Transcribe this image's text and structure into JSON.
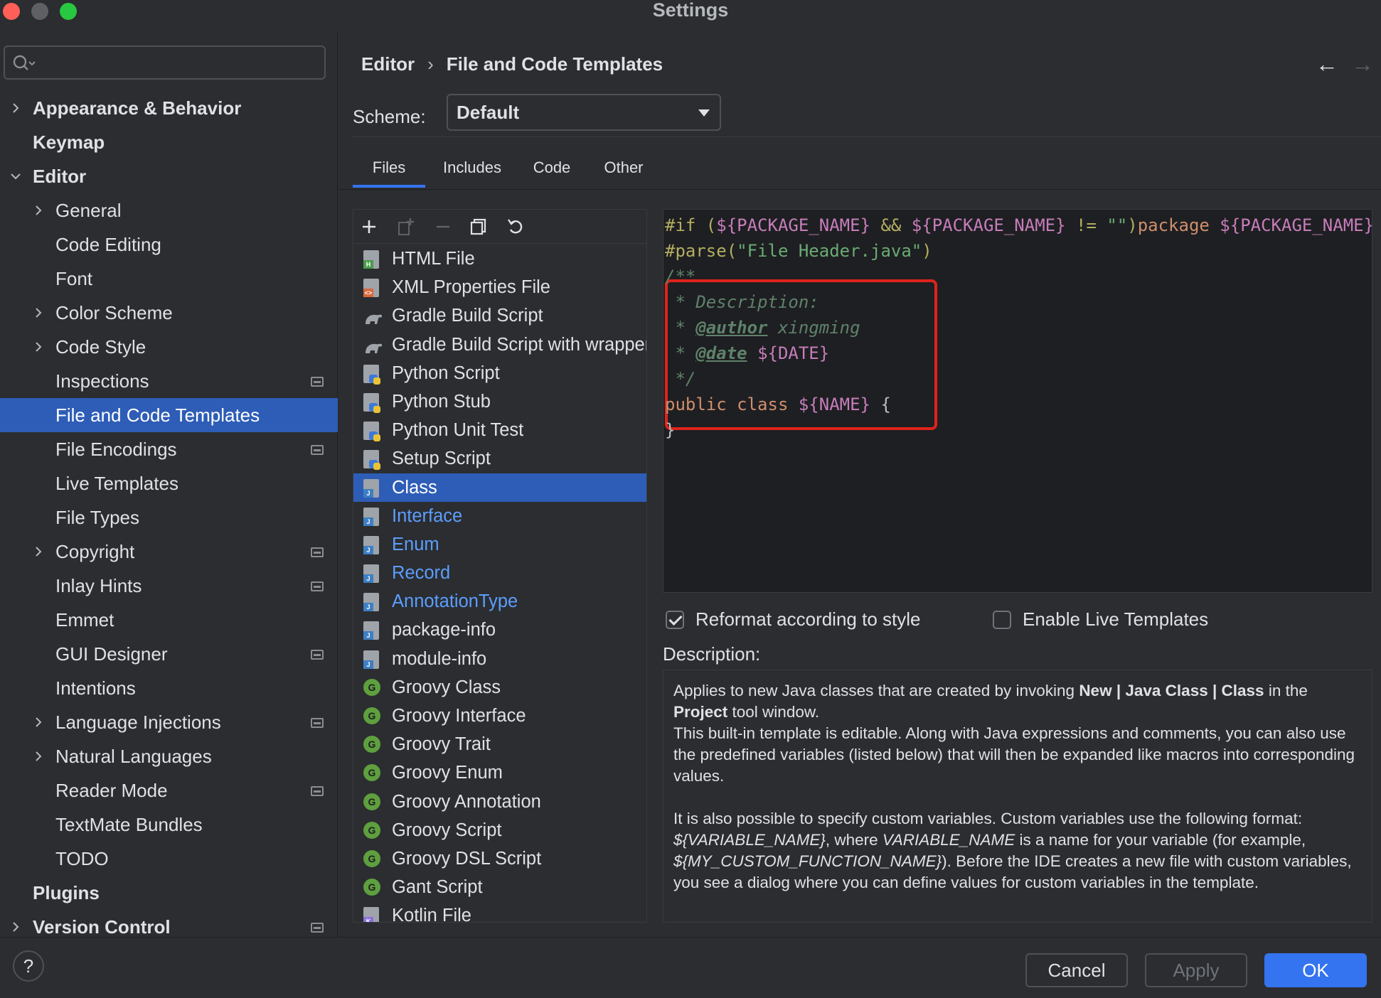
{
  "window": {
    "title": "Settings"
  },
  "search": {
    "placeholder": ""
  },
  "sidebar": {
    "items": [
      {
        "label": "Appearance & Behavior",
        "level": 0,
        "arrow": "right",
        "bold": true,
        "project": false
      },
      {
        "label": "Keymap",
        "level": 0,
        "arrow": "",
        "bold": true,
        "project": false
      },
      {
        "label": "Editor",
        "level": 0,
        "arrow": "down",
        "bold": true,
        "project": false
      },
      {
        "label": "General",
        "level": 1,
        "arrow": "right",
        "bold": false,
        "project": false
      },
      {
        "label": "Code Editing",
        "level": 1,
        "arrow": "",
        "bold": false,
        "project": false
      },
      {
        "label": "Font",
        "level": 1,
        "arrow": "",
        "bold": false,
        "project": false
      },
      {
        "label": "Color Scheme",
        "level": 1,
        "arrow": "right",
        "bold": false,
        "project": false
      },
      {
        "label": "Code Style",
        "level": 1,
        "arrow": "right",
        "bold": false,
        "project": false
      },
      {
        "label": "Inspections",
        "level": 1,
        "arrow": "",
        "bold": false,
        "project": true
      },
      {
        "label": "File and Code Templates",
        "level": 1,
        "arrow": "",
        "bold": false,
        "project": false,
        "selected": true
      },
      {
        "label": "File Encodings",
        "level": 1,
        "arrow": "",
        "bold": false,
        "project": true
      },
      {
        "label": "Live Templates",
        "level": 1,
        "arrow": "",
        "bold": false,
        "project": false
      },
      {
        "label": "File Types",
        "level": 1,
        "arrow": "",
        "bold": false,
        "project": false
      },
      {
        "label": "Copyright",
        "level": 1,
        "arrow": "right",
        "bold": false,
        "project": true
      },
      {
        "label": "Inlay Hints",
        "level": 1,
        "arrow": "",
        "bold": false,
        "project": true
      },
      {
        "label": "Emmet",
        "level": 1,
        "arrow": "",
        "bold": false,
        "project": false
      },
      {
        "label": "GUI Designer",
        "level": 1,
        "arrow": "",
        "bold": false,
        "project": true
      },
      {
        "label": "Intentions",
        "level": 1,
        "arrow": "",
        "bold": false,
        "project": false
      },
      {
        "label": "Language Injections",
        "level": 1,
        "arrow": "right",
        "bold": false,
        "project": true
      },
      {
        "label": "Natural Languages",
        "level": 1,
        "arrow": "right",
        "bold": false,
        "project": false
      },
      {
        "label": "Reader Mode",
        "level": 1,
        "arrow": "",
        "bold": false,
        "project": true
      },
      {
        "label": "TextMate Bundles",
        "level": 1,
        "arrow": "",
        "bold": false,
        "project": false
      },
      {
        "label": "TODO",
        "level": 1,
        "arrow": "",
        "bold": false,
        "project": false
      },
      {
        "label": "Plugins",
        "level": 0,
        "arrow": "",
        "bold": true,
        "project": false
      },
      {
        "label": "Version Control",
        "level": 0,
        "arrow": "right",
        "bold": true,
        "project": true
      }
    ]
  },
  "header": {
    "breadcrumb": [
      "Editor",
      "File and Code Templates"
    ],
    "separator": "›",
    "back": "←",
    "forward": "→"
  },
  "scheme": {
    "label": "Scheme:",
    "value": "Default"
  },
  "tabs": [
    {
      "label": "Files",
      "active": true
    },
    {
      "label": "Includes",
      "active": false
    },
    {
      "label": "Code",
      "active": false
    },
    {
      "label": "Other",
      "active": false
    }
  ],
  "templates": [
    {
      "label": "HTML File",
      "icon": "html-file-icon",
      "badge": "H",
      "badgeColor": "#4a9c4a",
      "style": "normal"
    },
    {
      "label": "XML Properties File",
      "icon": "xml-file-icon",
      "badge": "<>",
      "badgeColor": "#d9683c",
      "style": "normal"
    },
    {
      "label": "Gradle Build Script",
      "icon": "gradle-icon",
      "badge": "",
      "badgeColor": "",
      "style": "normal"
    },
    {
      "label": "Gradle Build Script with wrapper",
      "icon": "gradle-icon",
      "badge": "",
      "badgeColor": "",
      "style": "normal"
    },
    {
      "label": "Python Script",
      "icon": "python-file-icon",
      "badge": "",
      "badgeColor": "#3c78d8",
      "style": "normal"
    },
    {
      "label": "Python Stub",
      "icon": "python-file-icon",
      "badge": "",
      "badgeColor": "#3c78d8",
      "style": "normal"
    },
    {
      "label": "Python Unit Test",
      "icon": "python-file-icon",
      "badge": "",
      "badgeColor": "#3c78d8",
      "style": "normal"
    },
    {
      "label": "Setup Script",
      "icon": "python-file-icon",
      "badge": "",
      "badgeColor": "#3c78d8",
      "style": "normal"
    },
    {
      "label": "Class",
      "icon": "java-file-icon",
      "badge": "J",
      "badgeColor": "#3d7fc4",
      "style": "selected"
    },
    {
      "label": "Interface",
      "icon": "java-file-icon",
      "badge": "J",
      "badgeColor": "#3d7fc4",
      "style": "link"
    },
    {
      "label": "Enum",
      "icon": "java-file-icon",
      "badge": "J",
      "badgeColor": "#3d7fc4",
      "style": "link"
    },
    {
      "label": "Record",
      "icon": "java-file-icon",
      "badge": "J",
      "badgeColor": "#3d7fc4",
      "style": "link"
    },
    {
      "label": "AnnotationType",
      "icon": "java-file-icon",
      "badge": "J",
      "badgeColor": "#3d7fc4",
      "style": "link"
    },
    {
      "label": "package-info",
      "icon": "java-file-icon",
      "badge": "J",
      "badgeColor": "#3d7fc4",
      "style": "normal"
    },
    {
      "label": "module-info",
      "icon": "java-file-icon",
      "badge": "J",
      "badgeColor": "#3d7fc4",
      "style": "normal"
    },
    {
      "label": "Groovy Class",
      "icon": "groovy-icon",
      "badge": "G",
      "badgeColor": "#5e9f3e",
      "style": "normal"
    },
    {
      "label": "Groovy Interface",
      "icon": "groovy-icon",
      "badge": "G",
      "badgeColor": "#5e9f3e",
      "style": "normal"
    },
    {
      "label": "Groovy Trait",
      "icon": "groovy-icon",
      "badge": "G",
      "badgeColor": "#5e9f3e",
      "style": "normal"
    },
    {
      "label": "Groovy Enum",
      "icon": "groovy-icon",
      "badge": "G",
      "badgeColor": "#5e9f3e",
      "style": "normal"
    },
    {
      "label": "Groovy Annotation",
      "icon": "groovy-icon",
      "badge": "G",
      "badgeColor": "#5e9f3e",
      "style": "normal"
    },
    {
      "label": "Groovy Script",
      "icon": "groovy-icon",
      "badge": "G",
      "badgeColor": "#5e9f3e",
      "style": "normal"
    },
    {
      "label": "Groovy DSL Script",
      "icon": "groovy-icon",
      "badge": "G",
      "badgeColor": "#5e9f3e",
      "style": "normal"
    },
    {
      "label": "Gant Script",
      "icon": "groovy-icon",
      "badge": "G",
      "badgeColor": "#5e9f3e",
      "style": "normal"
    },
    {
      "label": "Kotlin File",
      "icon": "kotlin-file-icon",
      "badge": "K",
      "badgeColor": "#8c6ee0",
      "style": "normal"
    }
  ],
  "editor": {
    "lines": [
      [
        {
          "t": "#if (",
          "c": "dir"
        },
        {
          "t": "${PACKAGE_NAME}",
          "c": "var"
        },
        {
          "t": " && ",
          "c": "dir"
        },
        {
          "t": "${PACKAGE_NAME}",
          "c": "var"
        },
        {
          "t": " != ",
          "c": "dir"
        },
        {
          "t": "\"\"",
          "c": "str"
        },
        {
          "t": ")",
          "c": "dir"
        },
        {
          "t": "package ",
          "c": "kw"
        },
        {
          "t": "${PACKAGE_NAME};#end",
          "c": "var"
        }
      ],
      [
        {
          "t": "#parse(",
          "c": "dir"
        },
        {
          "t": "\"File Header.java\"",
          "c": "str"
        },
        {
          "t": ")",
          "c": "dir"
        }
      ],
      [
        {
          "t": "/**",
          "c": "com"
        }
      ],
      [
        {
          "t": " * Description:",
          "c": "com"
        }
      ],
      [
        {
          "t": " * ",
          "c": "com"
        },
        {
          "t": "@author",
          "c": "tag"
        },
        {
          "t": " xingming",
          "c": "com"
        }
      ],
      [
        {
          "t": " * ",
          "c": "com"
        },
        {
          "t": "@date",
          "c": "tag"
        },
        {
          "t": " ",
          "c": "com"
        },
        {
          "t": "${DATE}",
          "c": "var"
        }
      ],
      [
        {
          "t": " */",
          "c": "com"
        }
      ],
      [
        {
          "t": "public class ",
          "c": "kw"
        },
        {
          "t": "${NAME}",
          "c": "var"
        },
        {
          "t": " {",
          "c": "txt"
        }
      ],
      [
        {
          "t": "}",
          "c": "txt"
        }
      ]
    ]
  },
  "options": {
    "reformat": {
      "label": "Reformat according to style",
      "checked": true
    },
    "live_templates": {
      "label": "Enable Live Templates",
      "checked": false
    }
  },
  "description": {
    "label": "Description:",
    "p1_a": "Applies to new Java classes that are created by invoking ",
    "p1_b": "New | Java Class | Class",
    "p1_c": " in the ",
    "p1_d": "Project",
    "p1_e": " tool window.",
    "p2": "This built-in template is editable. Along with Java expressions and comments, you can also use the predefined variables (listed below) that will then be expanded like macros into corresponding values.",
    "p3_a": "It is also possible to specify custom variables. Custom variables use the following format: ",
    "p3_b": "${VARIABLE_NAME}",
    "p3_c": ", where ",
    "p3_d": "VARIABLE_NAME",
    "p3_e": " is a name for your variable (for example, ",
    "p3_f": "${MY_CUSTOM_FUNCTION_NAME}",
    "p3_g": "). Before the IDE creates a new file with custom variables, you see a dialog where you can define values for custom variables in the template."
  },
  "footer": {
    "help": "?",
    "cancel": "Cancel",
    "apply": "Apply",
    "ok": "OK"
  },
  "colors": {
    "accent": "#3574f0",
    "selection": "#2e5db7",
    "highlight_box": "#e0231b"
  }
}
